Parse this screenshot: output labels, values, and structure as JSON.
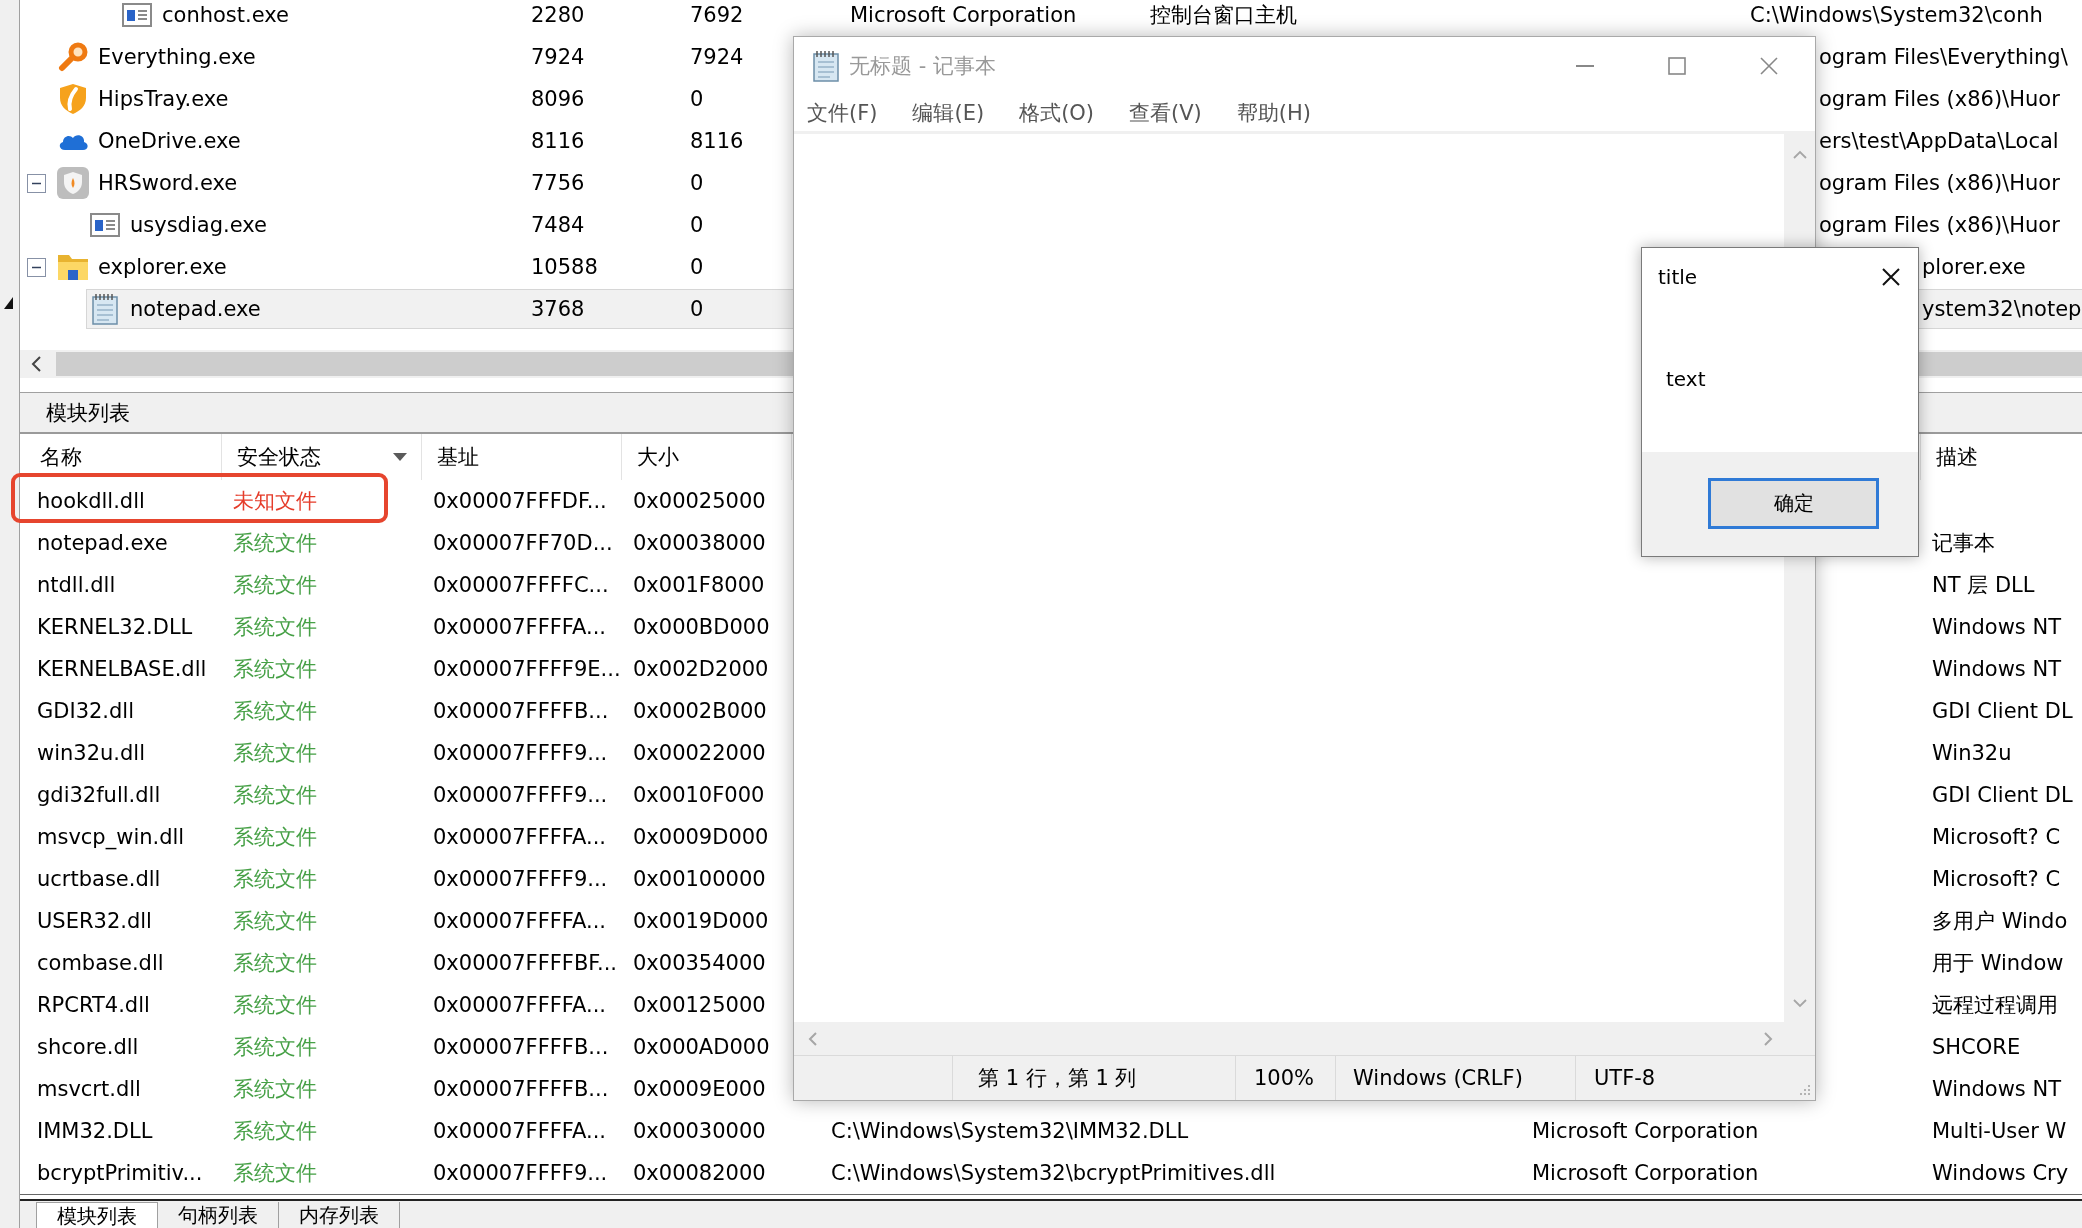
{
  "process_tree": {
    "rows": [
      {
        "children": [
          {
            "children": [
              {
                "name": "conhost.exe",
                "kind": "console",
                "expanded": false,
                "selected": false,
                "column_2": "2280",
                "column_3": "7692",
                "column_4": "Microsoft Corporation",
                "column_5": "控制台窗口主机",
                "column_6": "C:\\Windows\\System32\\conh"
              }
            ]
          }
        ]
      },
      {
        "name": "Everything.exe",
        "kind": "search",
        "expanded": false,
        "selected": false,
        "column_2": "7924",
        "column_3": "7924",
        "column_6": "ogram Files\\Everything\\"
      },
      {
        "name": "HipsTray.exe",
        "kind": "tray",
        "expanded": false,
        "selected": false,
        "column_2": "8096",
        "column_3": "0",
        "column_6": "ogram Files (x86)\\Huor"
      },
      {
        "name": "OneDrive.exe",
        "kind": "cloud",
        "expanded": false,
        "selected": false,
        "column_2": "8116",
        "column_3": "8116",
        "column_6": "ers\\test\\AppData\\Local"
      },
      {
        "name": "HRSword.exe",
        "kind": "tool",
        "expanded": true,
        "selected": false,
        "column_2": "7756",
        "column_3": "0",
        "column_6": "ogram Files (x86)\\Huor",
        "children": [
          {
            "name": "usysdiag.exe",
            "kind": "console",
            "expanded": false,
            "selected": false,
            "column_2": "7484",
            "column_3": "0",
            "column_6": "ogram Files (x86)\\Huor"
          }
        ]
      },
      {
        "name": "explorer.exe",
        "kind": "folder",
        "expanded": true,
        "selected": false,
        "column_2": "10588",
        "column_3": "0",
        "column_6": "plorer.exe",
        "children": [
          {
            "name": "notepad.exe",
            "kind": "editor",
            "expanded": false,
            "selected": true,
            "column_2": "3768",
            "column_3": "0",
            "column_6": "ystem32\\notep"
          }
        ]
      }
    ]
  },
  "notepad": {
    "title": "无标题 - 记事本",
    "menu": [
      "文件(F)",
      "编辑(E)",
      "格式(O)",
      "查看(V)",
      "帮助(H)"
    ],
    "status_bar": [
      "第 1 行，第 1 列",
      "100%",
      "Windows (CRLF)",
      "UTF-8"
    ]
  },
  "dialog": {
    "title": "title",
    "message": "text",
    "buttons": [
      {
        "label": "确定",
        "focused": true
      }
    ]
  },
  "module_panel": {
    "title": "模块列表",
    "columns": {
      "name": {
        "label": "名称",
        "sorted": false
      },
      "security_status": {
        "label": "安全状态",
        "sorted": true
      },
      "base_address": {
        "label": "基址",
        "sorted": false
      },
      "size": {
        "label": "大小",
        "sorted": false
      },
      "description": {
        "label": "描述",
        "sorted": false
      }
    },
    "rows": [
      {
        "name": "hookdll.dll",
        "security_status": "未知文件",
        "color": "#e53c2a",
        "base_address": "0x00007FFFDF...",
        "size": "0x00025000",
        "highlighted": true
      },
      {
        "name": "notepad.exe",
        "security_status": "系统文件",
        "color": "#46a046",
        "base_address": "0x00007FF70D...",
        "size": "0x00038000",
        "description": "记事本",
        "highlighted": false
      },
      {
        "name": "ntdll.dll",
        "security_status": "系统文件",
        "color": "#46a046",
        "base_address": "0x00007FFFFC...",
        "size": "0x001F8000",
        "description": "NT 层 DLL",
        "highlighted": false
      },
      {
        "name": "KERNEL32.DLL",
        "security_status": "系统文件",
        "color": "#46a046",
        "base_address": "0x00007FFFFA...",
        "size": "0x000BD000",
        "description": "Windows NT",
        "highlighted": false
      },
      {
        "name": "KERNELBASE.dll",
        "security_status": "系统文件",
        "color": "#46a046",
        "base_address": "0x00007FFFF9E...",
        "size": "0x002D2000",
        "description": "Windows NT",
        "highlighted": false
      },
      {
        "name": "GDI32.dll",
        "security_status": "系统文件",
        "color": "#46a046",
        "base_address": "0x00007FFFFB...",
        "size": "0x0002B000",
        "description": "GDI Client DL",
        "highlighted": false
      },
      {
        "name": "win32u.dll",
        "security_status": "系统文件",
        "color": "#46a046",
        "base_address": "0x00007FFFF9...",
        "size": "0x00022000",
        "description": "Win32u",
        "highlighted": false
      },
      {
        "name": "gdi32full.dll",
        "security_status": "系统文件",
        "color": "#46a046",
        "base_address": "0x00007FFFF9...",
        "size": "0x0010F000",
        "description": "GDI Client DL",
        "highlighted": false
      },
      {
        "name": "msvcp_win.dll",
        "security_status": "系统文件",
        "color": "#46a046",
        "base_address": "0x00007FFFFA...",
        "size": "0x0009D000",
        "description": "Microsoft? C",
        "highlighted": false
      },
      {
        "name": "ucrtbase.dll",
        "security_status": "系统文件",
        "color": "#46a046",
        "base_address": "0x00007FFFF9...",
        "size": "0x00100000",
        "description": "Microsoft? C",
        "highlighted": false
      },
      {
        "name": "USER32.dll",
        "security_status": "系统文件",
        "color": "#46a046",
        "base_address": "0x00007FFFFA...",
        "size": "0x0019D000",
        "description": "多用户 Windo",
        "highlighted": false
      },
      {
        "name": "combase.dll",
        "security_status": "系统文件",
        "color": "#46a046",
        "base_address": "0x00007FFFFBF...",
        "size": "0x00354000",
        "description": "用于 Window",
        "highlighted": false
      },
      {
        "name": "RPCRT4.dll",
        "security_status": "系统文件",
        "color": "#46a046",
        "base_address": "0x00007FFFFA...",
        "size": "0x00125000",
        "description": "远程过程调用",
        "highlighted": false
      },
      {
        "name": "shcore.dll",
        "security_status": "系统文件",
        "color": "#46a046",
        "base_address": "0x00007FFFFB...",
        "size": "0x000AD000",
        "description": "SHCORE",
        "highlighted": false
      },
      {
        "name": "msvcrt.dll",
        "security_status": "系统文件",
        "color": "#46a046",
        "base_address": "0x00007FFFFB...",
        "size": "0x0009E000",
        "description": "Windows NT",
        "highlighted": false
      },
      {
        "name": "IMM32.DLL",
        "security_status": "系统文件",
        "color": "#46a046",
        "base_address": "0x00007FFFFA...",
        "size": "0x00030000",
        "column_5": "C:\\Windows\\System32\\IMM32.DLL",
        "column_6": "Microsoft Corporation",
        "description": "Multi-User W",
        "highlighted": false
      },
      {
        "name": "bcryptPrimitiv...",
        "security_status": "系统文件",
        "color": "#46a046",
        "base_address": "0x00007FFFF9...",
        "size": "0x00082000",
        "column_5": "C:\\Windows\\System32\\bcryptPrimitives.dll",
        "column_6": "Microsoft Corporation",
        "description": "Windows Cry",
        "highlighted": false
      }
    ]
  },
  "bottom_tabs": [
    {
      "label": "模块列表",
      "selected": true
    },
    {
      "label": "句柄列表",
      "selected": false
    },
    {
      "label": "内存列表",
      "selected": false
    }
  ]
}
